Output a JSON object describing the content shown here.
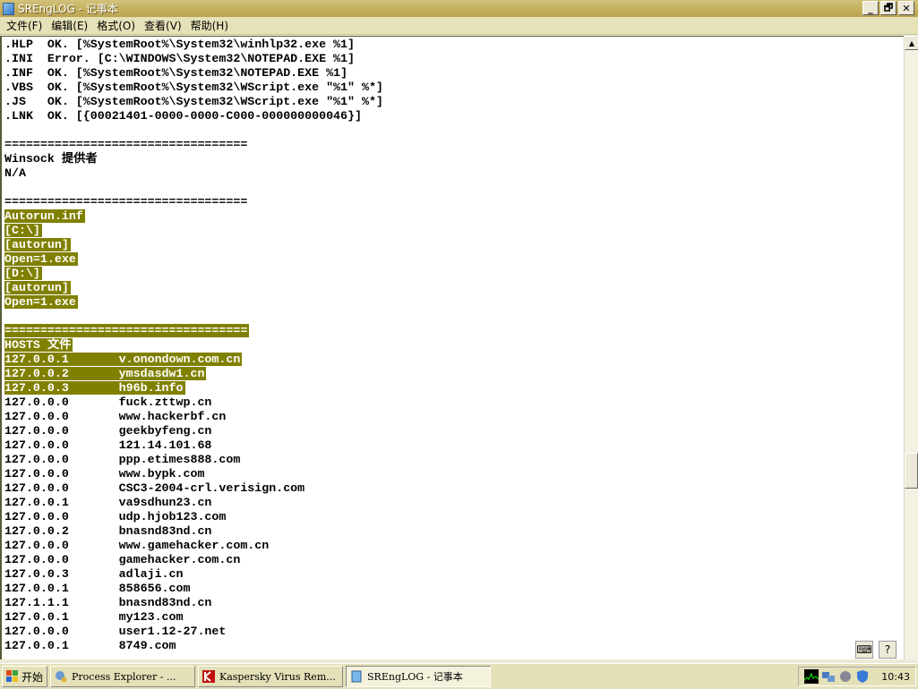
{
  "window": {
    "title": "SREngLOG - 记事本",
    "minimize": "_",
    "restore": "🗗",
    "close": "✕"
  },
  "menu": [
    "文件(F)",
    "编辑(E)",
    "格式(O)",
    "查看(V)",
    "帮助(H)"
  ],
  "lines": [
    {
      "t": ".HLP  OK. [%SystemRoot%\\System32\\winhlp32.exe %1]"
    },
    {
      "t": ".INI  Error. [C:\\WINDOWS\\System32\\NOTEPAD.EXE %1]"
    },
    {
      "t": ".INF  OK. [%SystemRoot%\\System32\\NOTEPAD.EXE %1]"
    },
    {
      "t": ".VBS  OK. [%SystemRoot%\\System32\\WScript.exe \"%1\" %*]"
    },
    {
      "t": ".JS   OK. [%SystemRoot%\\System32\\WScript.exe \"%1\" %*]"
    },
    {
      "t": ".LNK  OK. [{00021401-0000-0000-C000-000000000046}]"
    },
    {
      "t": ""
    },
    {
      "t": "=================================="
    },
    {
      "t": "Winsock 提供者"
    },
    {
      "t": "N/A"
    },
    {
      "t": ""
    },
    {
      "t": "=================================="
    },
    {
      "t": "Autorun.inf",
      "h": true
    },
    {
      "t": "[C:\\]",
      "h": true
    },
    {
      "t": "[autorun]",
      "h": true
    },
    {
      "t": "Open=1.exe",
      "h": true
    },
    {
      "t": "[D:\\]",
      "h": true
    },
    {
      "t": "[autorun]",
      "h": true
    },
    {
      "t": "Open=1.exe",
      "h": true
    },
    {
      "t": ""
    },
    {
      "t": "==================================",
      "h": true
    },
    {
      "t": "HOSTS 文件",
      "h": true
    },
    {
      "t": "127.0.0.1       v.onondown.com.cn",
      "h": true
    },
    {
      "t": "127.0.0.2       ymsdasdw1.cn",
      "h": true
    },
    {
      "t": "127.0.0.3       h96b.info",
      "h": true
    },
    {
      "t": "127.0.0.0       fuck.zttwp.cn"
    },
    {
      "t": "127.0.0.0       www.hackerbf.cn"
    },
    {
      "t": "127.0.0.0       geekbyfeng.cn"
    },
    {
      "t": "127.0.0.0       121.14.101.68"
    },
    {
      "t": "127.0.0.0       ppp.etimes888.com"
    },
    {
      "t": "127.0.0.0       www.bypk.com"
    },
    {
      "t": "127.0.0.0       CSC3-2004-crl.verisign.com"
    },
    {
      "t": "127.0.0.1       va9sdhun23.cn"
    },
    {
      "t": "127.0.0.0       udp.hjob123.com"
    },
    {
      "t": "127.0.0.2       bnasnd83nd.cn"
    },
    {
      "t": "127.0.0.0       www.gamehacker.com.cn"
    },
    {
      "t": "127.0.0.0       gamehacker.com.cn"
    },
    {
      "t": "127.0.0.3       adlaji.cn"
    },
    {
      "t": "127.0.0.1       858656.com"
    },
    {
      "t": "127.1.1.1       bnasnd83nd.cn"
    },
    {
      "t": "127.0.0.1       my123.com"
    },
    {
      "t": "127.0.0.0       user1.12-27.net"
    },
    {
      "t": "127.0.0.1       8749.com"
    }
  ],
  "colors": {
    "highlight": "#808000"
  },
  "taskbar": {
    "start": "开始",
    "tasks": [
      "Process Explorer - ...",
      "Kaspersky Virus Rem...",
      "SREngLOG - 记事本"
    ],
    "clock": "10:43"
  },
  "langbar": {
    "keyboard": "⌨",
    "help": "?"
  }
}
